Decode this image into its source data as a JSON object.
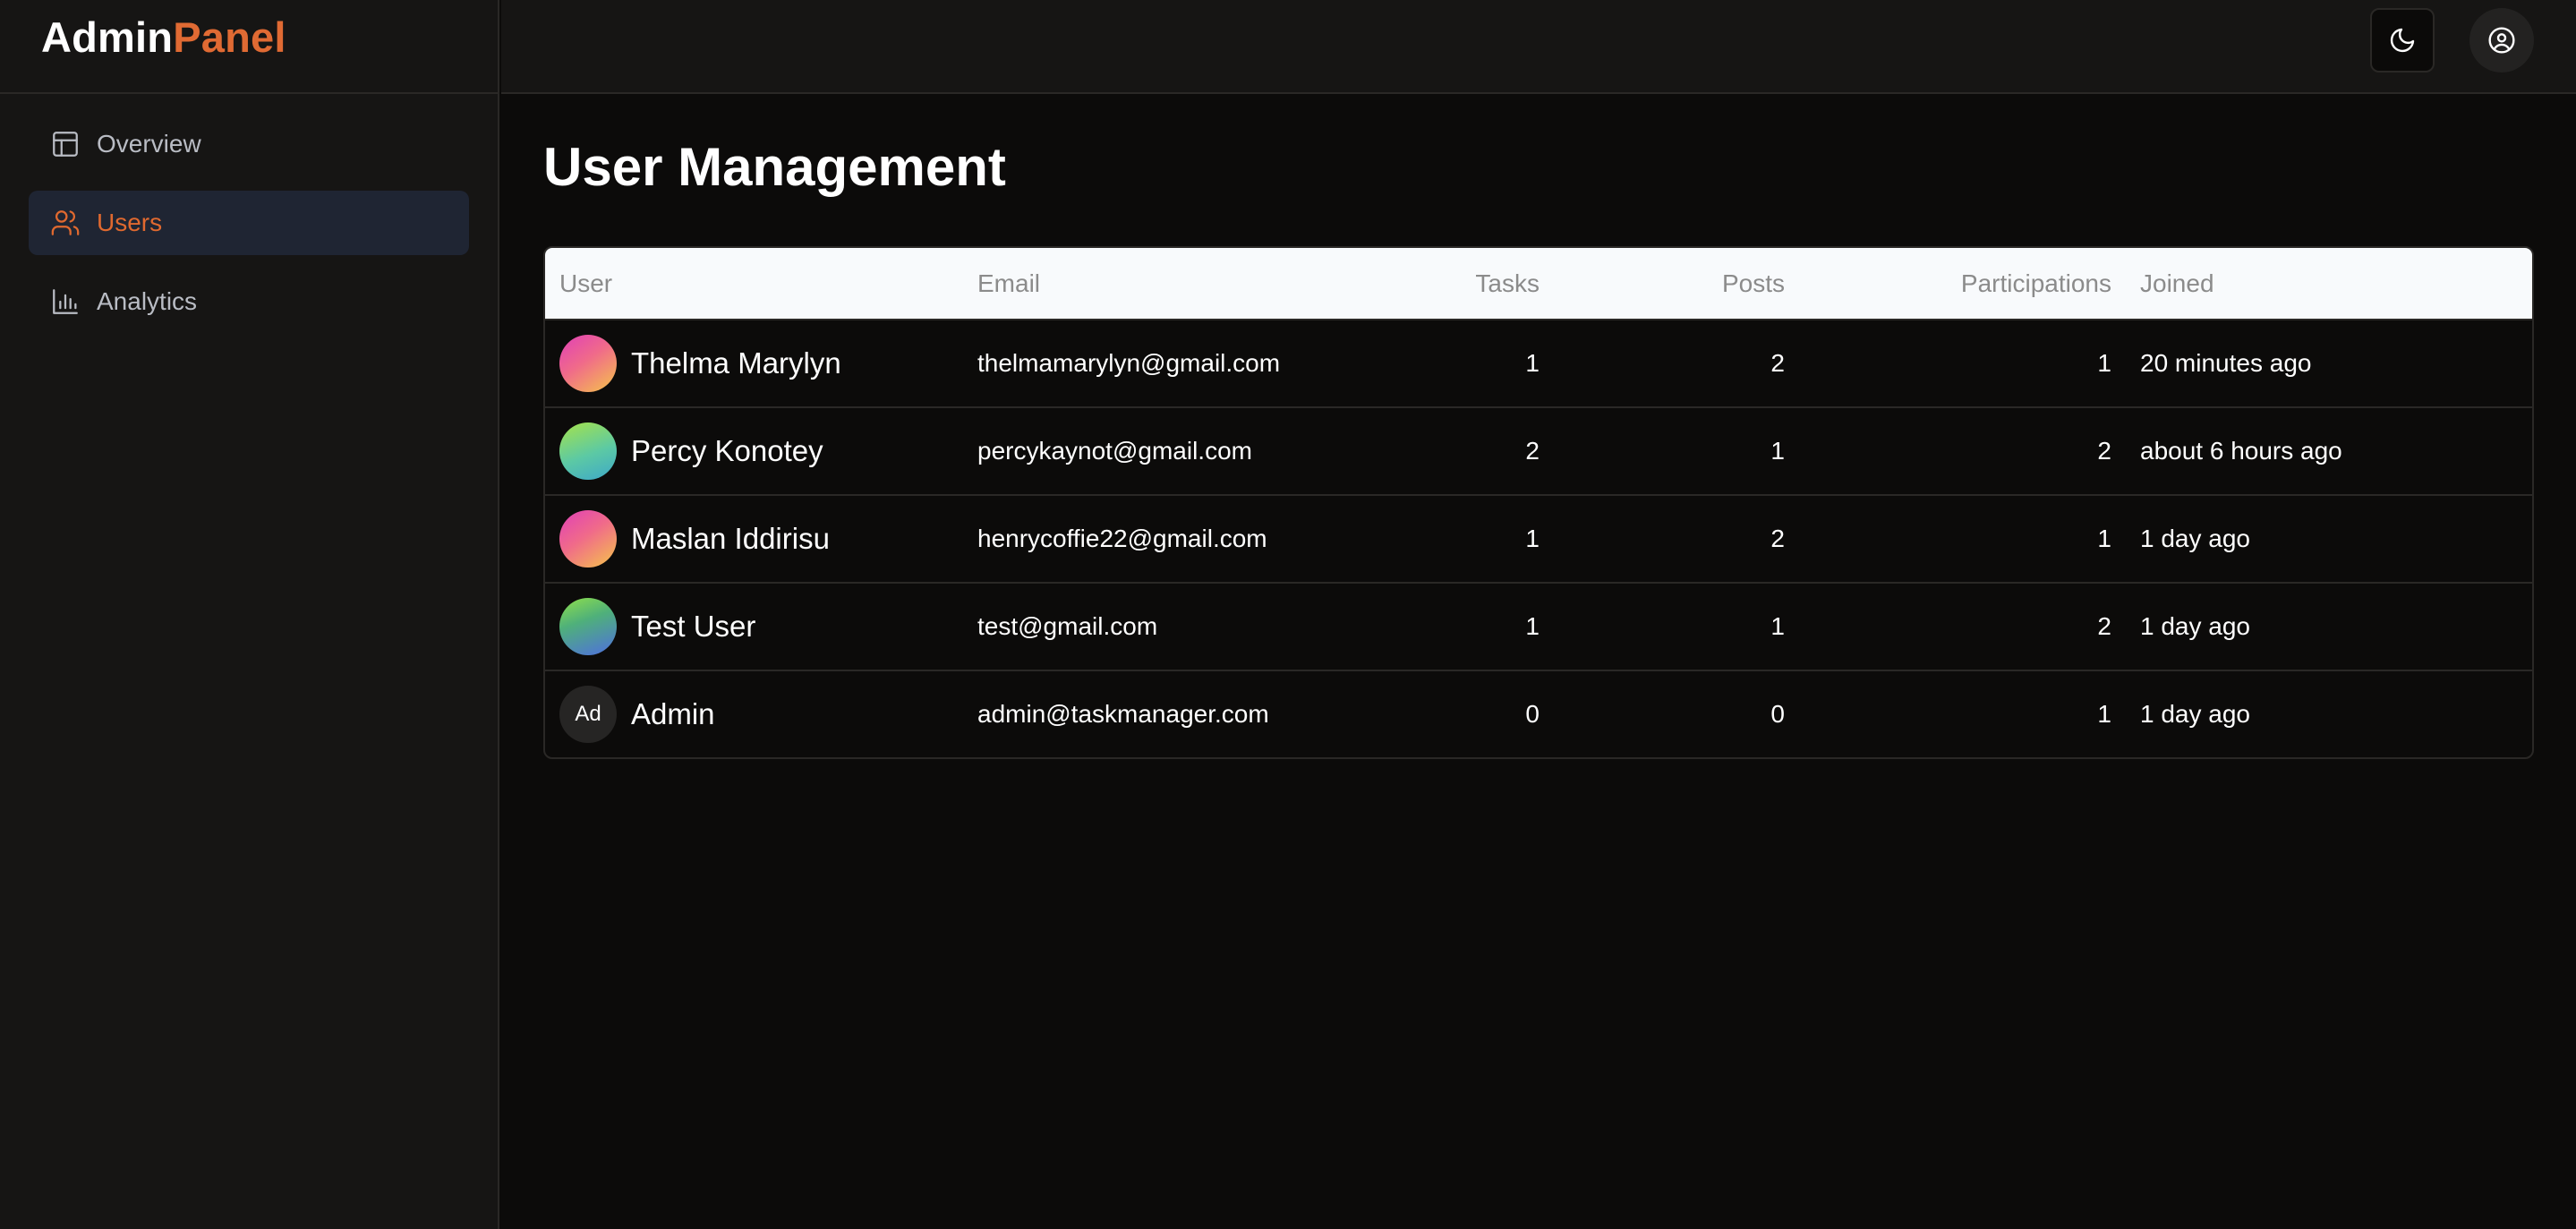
{
  "brand": {
    "part1": "Admin",
    "part2": "Panel"
  },
  "sidebar": {
    "items": [
      {
        "label": "Overview",
        "icon": "layout-icon",
        "active": false
      },
      {
        "label": "Users",
        "icon": "users-icon",
        "active": true
      },
      {
        "label": "Analytics",
        "icon": "bar-chart-icon",
        "active": false
      }
    ]
  },
  "topbar": {
    "theme_icon": "moon-icon",
    "user_icon": "user-circle-icon"
  },
  "main": {
    "title": "User Management"
  },
  "table": {
    "headers": {
      "user": "User",
      "email": "Email",
      "tasks": "Tasks",
      "posts": "Posts",
      "participations": "Participations",
      "joined": "Joined"
    },
    "rows": [
      {
        "name": "Thelma Marylyn",
        "email": "thelmamarylyn@gmail.com",
        "tasks": "1",
        "posts": "2",
        "participations": "1",
        "joined": "20 minutes ago",
        "avatar": "gradient-pink"
      },
      {
        "name": "Percy Konotey",
        "email": "percykaynot@gmail.com",
        "tasks": "2",
        "posts": "1",
        "participations": "2",
        "joined": "about 6 hours ago",
        "avatar": "gradient-green"
      },
      {
        "name": "Maslan Iddirisu",
        "email": "henrycoffie22@gmail.com",
        "tasks": "1",
        "posts": "2",
        "participations": "1",
        "joined": "1 day ago",
        "avatar": "gradient-pink"
      },
      {
        "name": "Test User",
        "email": "test@gmail.com",
        "tasks": "1",
        "posts": "1",
        "participations": "2",
        "joined": "1 day ago",
        "avatar": "gradient-green-blue"
      },
      {
        "name": "Admin",
        "email": "admin@taskmanager.com",
        "tasks": "0",
        "posts": "0",
        "participations": "1",
        "joined": "1 day ago",
        "avatar": "initials",
        "initials": "Ad"
      }
    ]
  },
  "colors": {
    "accent": "#e0692f",
    "background": "#0c0b0a",
    "sidebar": "#161514",
    "active_item_bg": "#1f2533"
  }
}
